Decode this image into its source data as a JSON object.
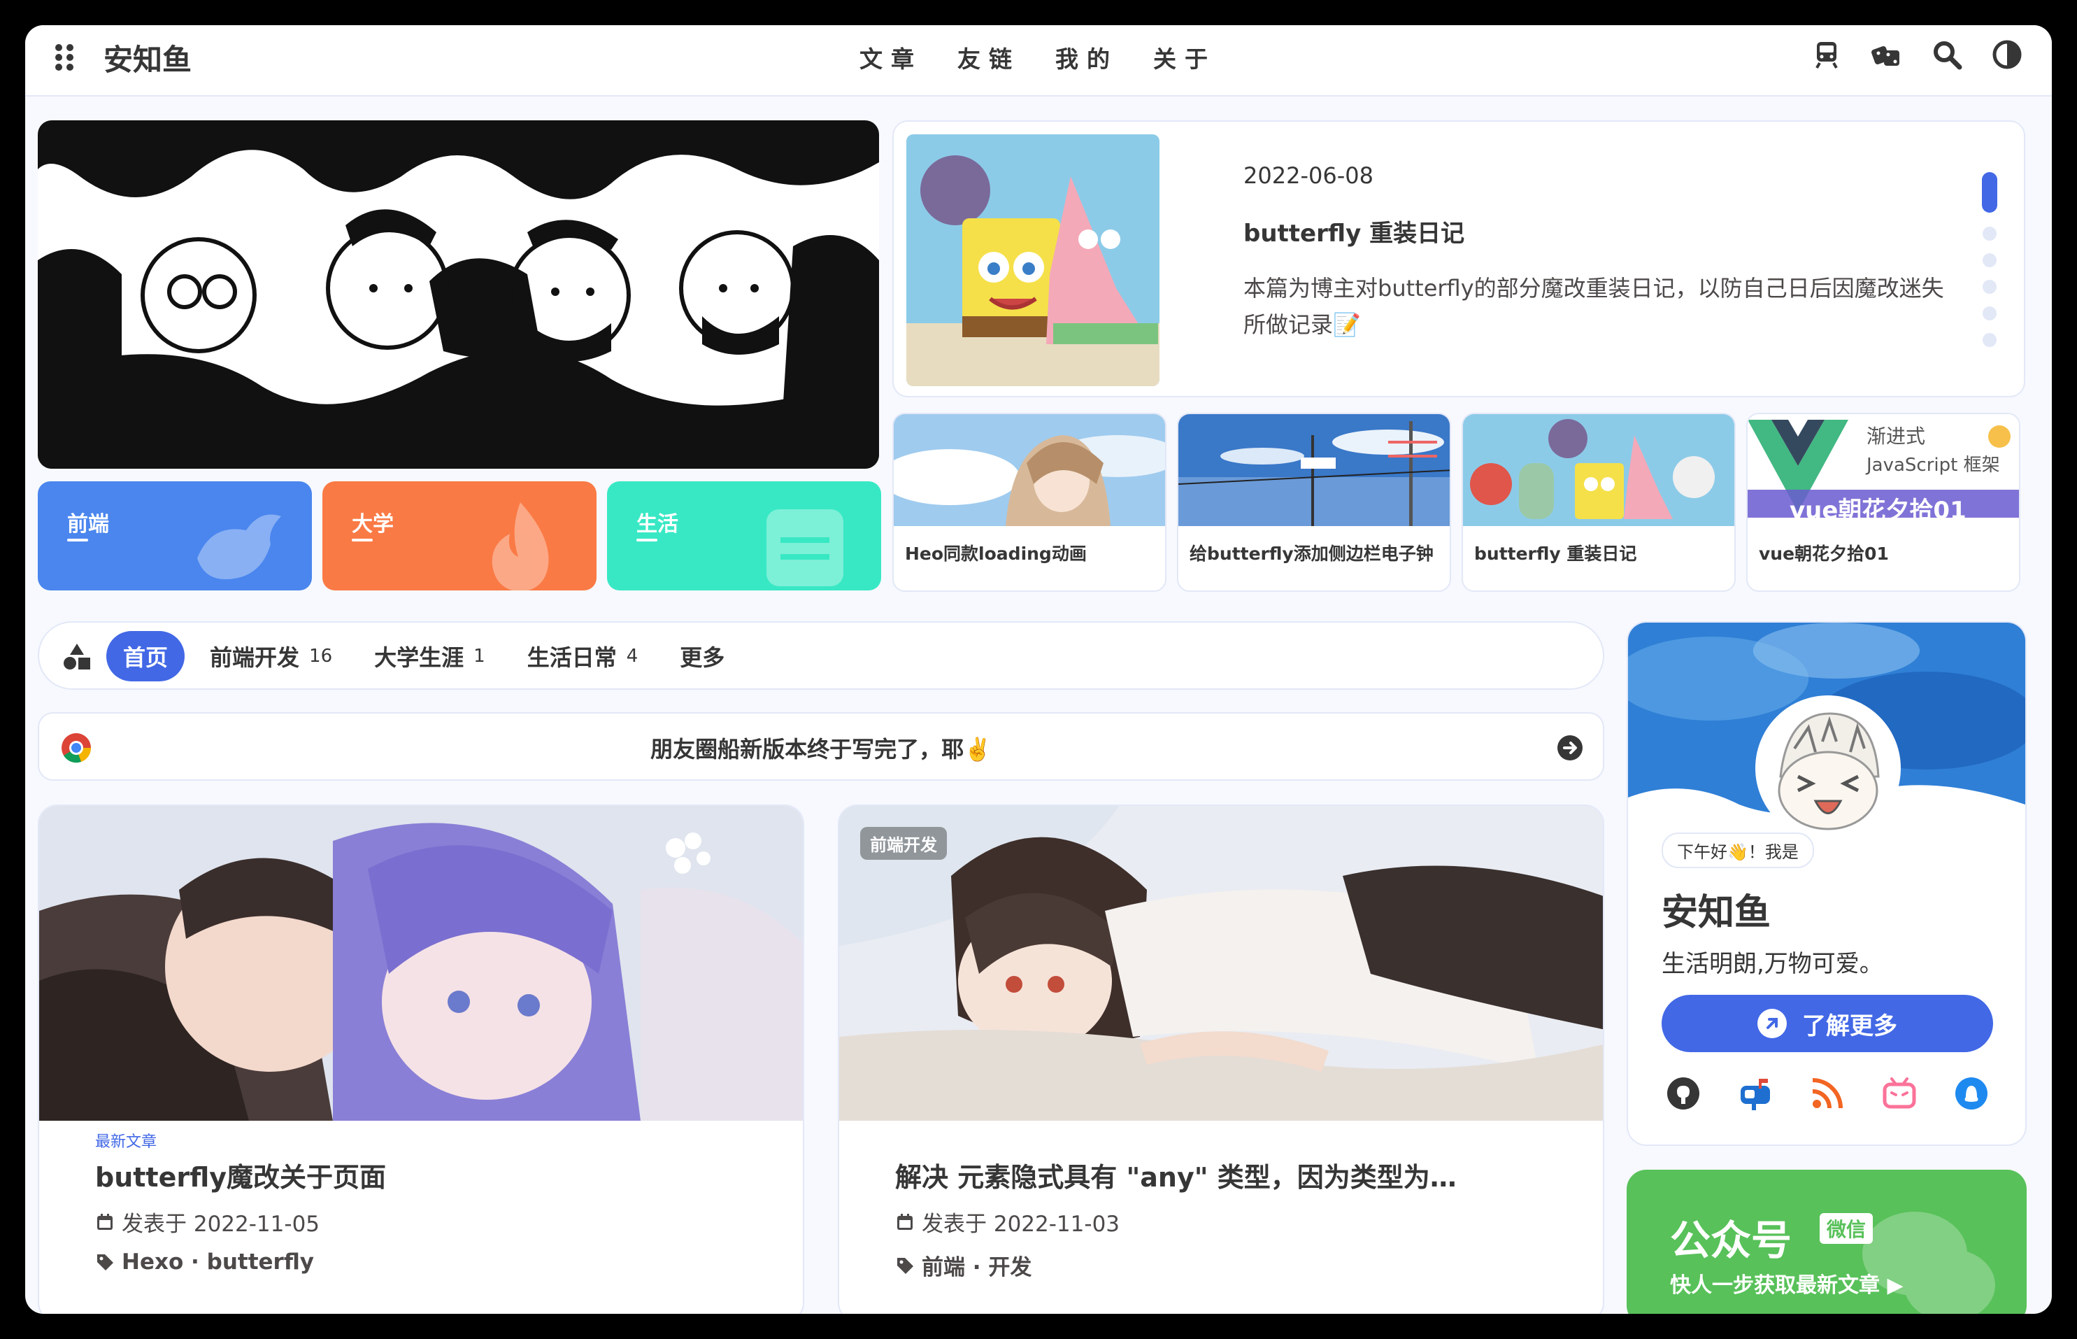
{
  "navbar": {
    "site_name": "安知鱼",
    "links": [
      "文章",
      "友链",
      "我的",
      "关于"
    ],
    "icons": [
      "train-icon",
      "dice-icon",
      "search-icon",
      "theme-toggle-icon"
    ]
  },
  "hero": {
    "categories": [
      {
        "label": "前端",
        "color": "#4a86ee"
      },
      {
        "label": "大学",
        "color": "#fa7a45"
      },
      {
        "label": "生活",
        "color": "#38e8c4"
      }
    ]
  },
  "featured": {
    "date": "2022-06-08",
    "title": "butterfly 重装日记",
    "description": "本篇为博主对butterfly的部分魔改重装日记，以防自己日后因魔改迷失所做记录📝",
    "slide_index": 0,
    "slide_count": 6
  },
  "recent": [
    {
      "title": "Heo同款loading动画"
    },
    {
      "title": "给butterfly添加侧边栏电子钟"
    },
    {
      "title": "butterfly 重装日记"
    },
    {
      "title": "vue朝花夕拾01",
      "cover_text_1": "渐进式",
      "cover_text_2": "JavaScript 框架",
      "cover_text_3": "vue朝花夕拾01"
    }
  ],
  "category_bar": {
    "items": [
      {
        "label": "首页",
        "count": "",
        "active": true
      },
      {
        "label": "前端开发",
        "count": "16",
        "active": false
      },
      {
        "label": "大学生涯",
        "count": "1",
        "active": false
      },
      {
        "label": "生活日常",
        "count": "4",
        "active": false
      },
      {
        "label": "更多",
        "count": "",
        "active": false
      }
    ]
  },
  "announcement": {
    "text": "朋友圈船新版本终于写完了，耶✌️"
  },
  "posts": [
    {
      "badge": "",
      "label": "最新文章",
      "title": "butterfly魔改关于页面",
      "date": "发表于 2022-11-05",
      "tags": "Hexo · butterfly"
    },
    {
      "badge": "前端开发",
      "label": "",
      "title": "解决 元素隐式具有 \"any\" 类型，因为类型为…",
      "date": "发表于 2022-11-03",
      "tags": "前端 · 开发"
    }
  ],
  "author": {
    "greeting": "下午好👋！我是",
    "name": "安知鱼",
    "description": "生活明朗,万物可爱。",
    "button": "了解更多",
    "socials": [
      "github-icon",
      "mailbox-icon",
      "rss-icon",
      "bilibili-icon",
      "qq-icon"
    ]
  },
  "wechat": {
    "title": "公众号",
    "badge": "微信",
    "subtitle": "快人一步获取最新文章 ▶"
  },
  "colors": {
    "accent": "#4268e6",
    "wechat_green": "#58c15a"
  }
}
